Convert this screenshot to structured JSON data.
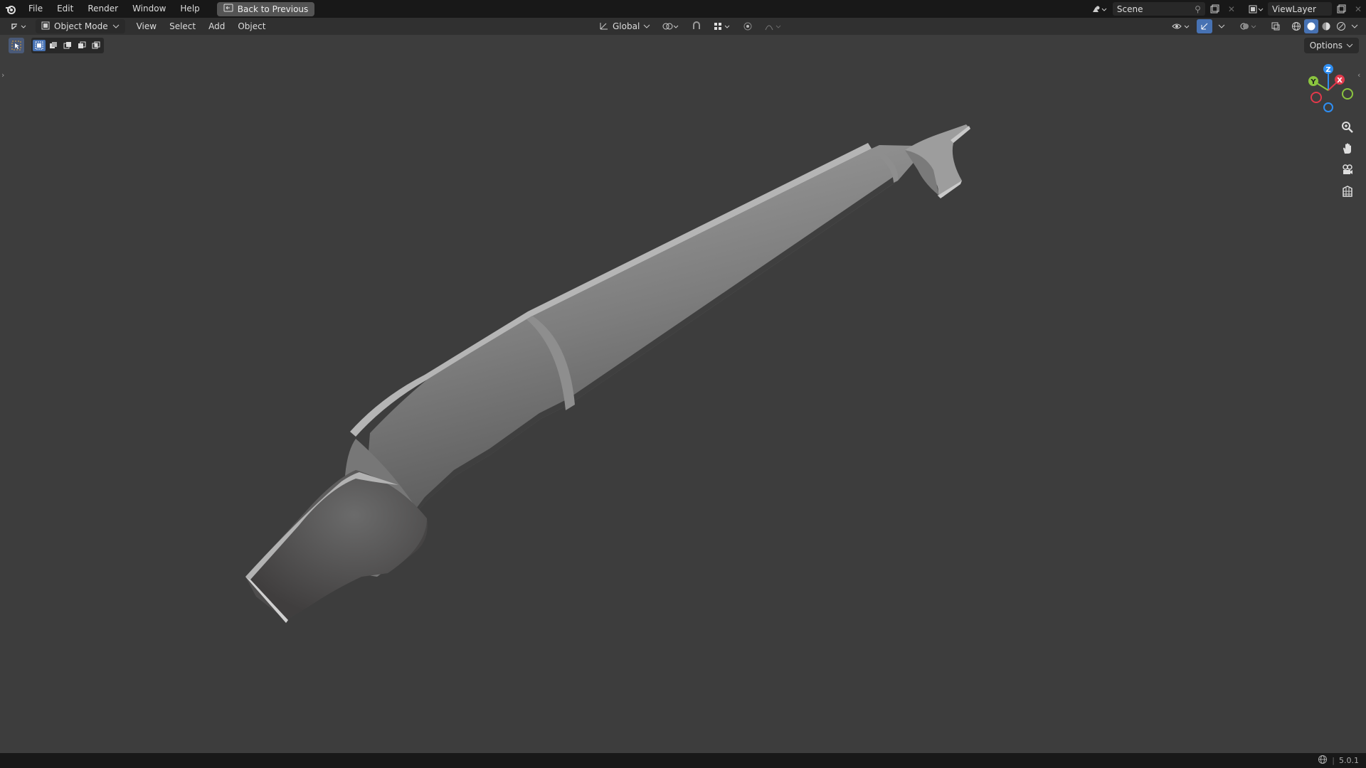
{
  "menu": {
    "items": [
      "File",
      "Edit",
      "Render",
      "Window",
      "Help"
    ],
    "back_button": "Back to Previous"
  },
  "top_right": {
    "scene_label": "Scene",
    "view_layer_label": "ViewLayer"
  },
  "header": {
    "mode": "Object Mode",
    "menus": [
      "View",
      "Select",
      "Add",
      "Object"
    ],
    "transform_orientation": "Global"
  },
  "options_label": "Options",
  "status": {
    "version": "5.0.1"
  },
  "colors": {
    "accent": "#4772b3",
    "axis_x": "#e2394b",
    "axis_y": "#8bc53f",
    "axis_z": "#2f8ef2",
    "viewport_bg": "#3d3d3d"
  },
  "gizmo": {
    "x_label": "X",
    "y_label": "Y",
    "z_label": "Z"
  }
}
